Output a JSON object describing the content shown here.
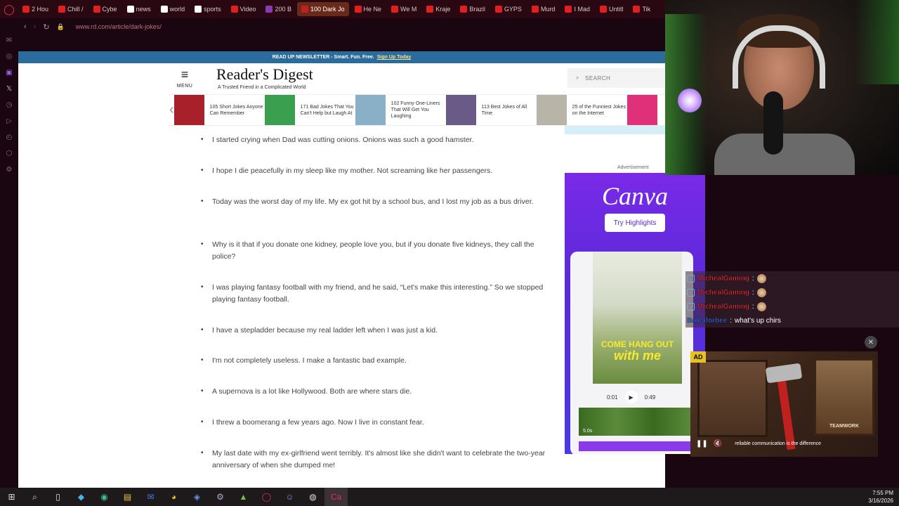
{
  "browser": {
    "tabs": [
      {
        "label": "2 Hou",
        "color": "#e02020"
      },
      {
        "label": "Chill /",
        "color": "#e02020"
      },
      {
        "label": "Cybe",
        "color": "#e02020"
      },
      {
        "label": "news",
        "color": "#ffffff"
      },
      {
        "label": "world",
        "color": "#ffffff"
      },
      {
        "label": "sports",
        "color": "#ffffff"
      },
      {
        "label": "Video",
        "color": "#e02020"
      },
      {
        "label": "200 B",
        "color": "#8a3ab0"
      },
      {
        "label": "100 Dark Jo",
        "color": "#c02020",
        "active": true
      },
      {
        "label": "He Ne",
        "color": "#e02020"
      },
      {
        "label": "We M",
        "color": "#e02020"
      },
      {
        "label": "Kraje",
        "color": "#e02020"
      },
      {
        "label": "Brazil",
        "color": "#e02020"
      },
      {
        "label": "GYPS",
        "color": "#e02020"
      },
      {
        "label": "Murd",
        "color": "#e02020"
      },
      {
        "label": "I Mad",
        "color": "#e02020"
      },
      {
        "label": "Untitl",
        "color": "#e02020"
      },
      {
        "label": "Tik",
        "color": "#e02020"
      }
    ],
    "url": "www.rd.com/article/dark-jokes/"
  },
  "site": {
    "newsletter_text": "READ UP NEWSLETTER - Smart. Fun. Free.",
    "newsletter_link": "Sign Up Today",
    "menu_label": "MENU",
    "logo_name": "Reader's Digest",
    "logo_tagline": "A Trusted Friend in a Complicated World",
    "search_placeholder": "SEARCH",
    "advertisement_label": "Advertisement"
  },
  "carousel": [
    {
      "title": "105 Short Jokes Anyone Can Remember",
      "thumb": "#a8202a"
    },
    {
      "title": "171 Bad Jokes That You Can't Help but Laugh At",
      "thumb": "#3aa050"
    },
    {
      "title": "102 Funny One-Liners That Will Get You Laughing",
      "thumb": "#8ab0c8"
    },
    {
      "title": "113 Best Jokes of All Time",
      "thumb": "#6a5a88"
    },
    {
      "title": "25 of the Funniest Jokes on the Internet",
      "thumb": "#b8b4a8"
    },
    {
      "title": "",
      "thumb": "#e0307a"
    }
  ],
  "jokes": [
    "I started crying when Dad was cutting onions. Onions was such a good hamster.",
    "I hope I die peacefully in my sleep like my mother. Not screaming like her passengers.",
    "Today was the worst day of my life. My ex got hit by a school bus, and I lost my job as a bus driver.",
    "Why is it that if you donate one kidney, people love you, but if you donate five kidneys, they call the police?",
    "I was playing fantasy football with my friend, and he said, “Let's make this interesting.” So we stopped playing fantasy football.",
    "I have a stepladder because my real ladder left when I was just a kid.",
    "I'm not completely useless. I make a fantastic bad example.",
    "A supernova is a lot like Hollywood. Both are where stars die.",
    "I threw a boomerang a few years ago. Now I live in constant fear.",
    "My last date with my ex-girlfriend went terribly. It's almost like she didn't want to celebrate the two-year anniversary of when she dumped me!"
  ],
  "canva_ad": {
    "brand": "Canva",
    "cta": "Try Highlights",
    "overlay_line1": "COME HANG OUT",
    "overlay_line2": "with me",
    "time_start": "0:01",
    "time_end": "0:49",
    "clip_len": "5.0s"
  },
  "chat": [
    {
      "user": "MichealGaming",
      "text": "",
      "color": "#e0303a",
      "emote": true
    },
    {
      "user": "MichealGaming",
      "text": "",
      "color": "#e0303a",
      "emote": true
    },
    {
      "user": "MichealGaming",
      "text": "",
      "color": "#e0303a",
      "emote": true
    },
    {
      "user": "Baleaforbee",
      "text": "what's up chirs",
      "color": "#3a6ae8",
      "emote": false
    }
  ],
  "video_ad": {
    "tag": "AD",
    "caption": "reliable communication is the difference",
    "plaque_text": "TEAMWORK"
  },
  "taskbar": {
    "time": "7:55 PM",
    "date": "3/16/2026"
  }
}
